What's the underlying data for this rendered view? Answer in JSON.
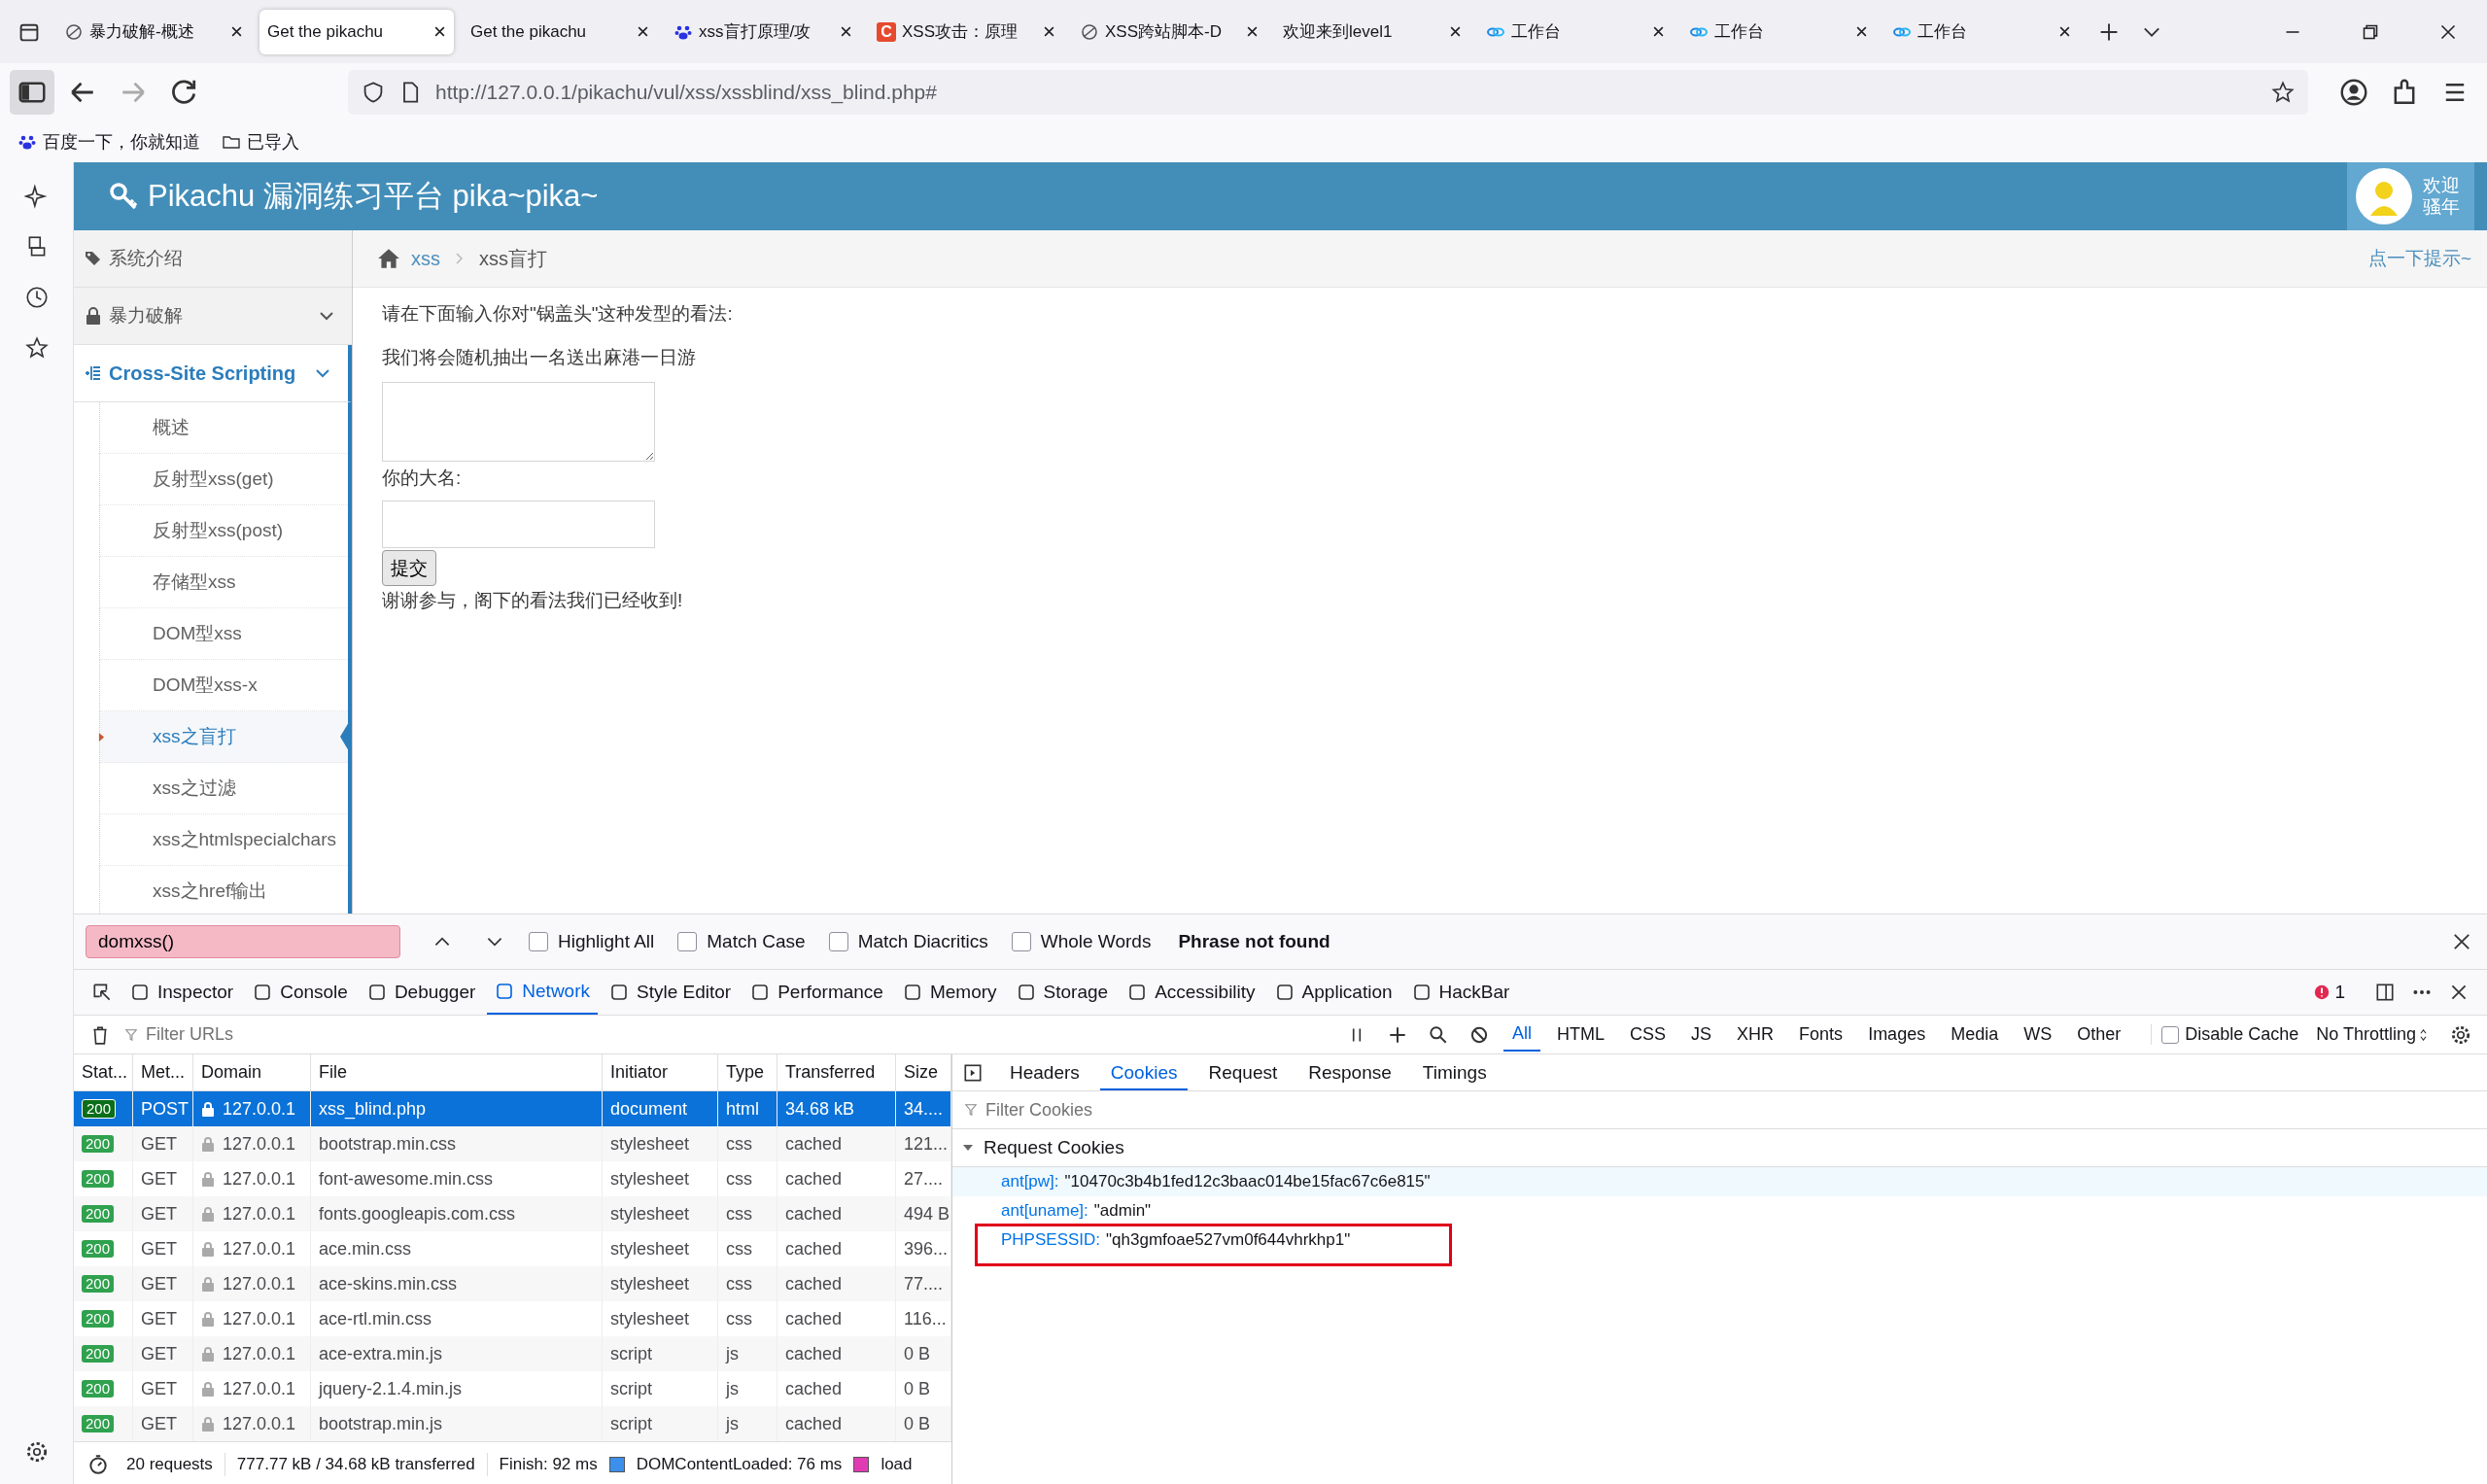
{
  "browser": {
    "tabs": [
      {
        "label": "暴力破解-概述",
        "selected": false
      },
      {
        "label": "Get the pikachu",
        "selected": true
      },
      {
        "label": "Get the pikachu",
        "selected": false
      },
      {
        "label": "xss盲打原理/攻",
        "selected": false
      },
      {
        "label": "XSS攻击：原理",
        "selected": false,
        "icon_text": "C"
      },
      {
        "label": "XSS跨站脚本-D",
        "selected": false
      },
      {
        "label": "欢迎来到level1",
        "selected": false
      },
      {
        "label": "工作台",
        "selected": false
      },
      {
        "label": "工作台",
        "selected": false
      },
      {
        "label": "工作台",
        "selected": false
      }
    ],
    "url_host": "http://127.0.0.1",
    "url_path": "/pikachu/vul/xss/xssblind/xss_blind.php#",
    "bookmarks": [
      {
        "label": "百度一下，你就知道"
      },
      {
        "label": "已导入"
      }
    ]
  },
  "page": {
    "title": "Pikachu 漏洞练习平台 pika~pika~",
    "welcome": [
      "欢迎",
      "骚年"
    ],
    "sidebar": [
      {
        "label": "系统介绍"
      },
      {
        "label": "暴力破解",
        "expanded": false
      },
      {
        "label": "Cross-Site Scripting",
        "expanded": true,
        "children": [
          {
            "label": "概述",
            "selected": false
          },
          {
            "label": "反射型xss(get)",
            "selected": false
          },
          {
            "label": "反射型xss(post)",
            "selected": false
          },
          {
            "label": "存储型xss",
            "selected": false
          },
          {
            "label": "DOM型xss",
            "selected": false
          },
          {
            "label": "DOM型xss-x",
            "selected": false
          },
          {
            "label": "xss之盲打",
            "selected": true
          },
          {
            "label": "xss之过滤",
            "selected": false
          },
          {
            "label": "xss之htmlspecialchars",
            "selected": false
          },
          {
            "label": "xss之href输出",
            "selected": false
          }
        ]
      }
    ],
    "breadcrumb": [
      "xss",
      "xss盲打"
    ],
    "hint_link": "点一下提示~",
    "prompt": "请在下面输入你对\"锅盖头\"这种发型的看法:",
    "prompt_2": "我们将会随机抽出一名送出麻港一日游",
    "name_label": "你的大名:",
    "submit": "提交",
    "thanks": "谢谢参与，阁下的看法我们已经收到!"
  },
  "find_bar": {
    "value": "domxss()",
    "options": [
      {
        "label": "Highlight All",
        "checked": false
      },
      {
        "label": "Match Case",
        "checked": false
      },
      {
        "label": "Match Diacritics",
        "checked": false
      },
      {
        "label": "Whole Words",
        "checked": false
      }
    ],
    "status": "Phrase not found"
  },
  "devtools": {
    "tools": [
      {
        "label": "Inspector",
        "selected": false
      },
      {
        "label": "Console",
        "selected": false
      },
      {
        "label": "Debugger",
        "selected": false
      },
      {
        "label": "Network",
        "selected": true
      },
      {
        "label": "Style Editor",
        "selected": false
      },
      {
        "label": "Performance",
        "selected": false
      },
      {
        "label": "Memory",
        "selected": false
      },
      {
        "label": "Storage",
        "selected": false
      },
      {
        "label": "Accessibility",
        "selected": false
      },
      {
        "label": "Application",
        "selected": false
      },
      {
        "label": "HackBar",
        "selected": false
      }
    ],
    "error_count": "1",
    "filter_placeholder": "Filter URLs",
    "type_filters": [
      {
        "label": "All",
        "selected": true
      },
      {
        "label": "HTML",
        "selected": false
      },
      {
        "label": "CSS",
        "selected": false
      },
      {
        "label": "JS",
        "selected": false
      },
      {
        "label": "XHR",
        "selected": false
      },
      {
        "label": "Fonts",
        "selected": false
      },
      {
        "label": "Images",
        "selected": false
      },
      {
        "label": "Media",
        "selected": false
      },
      {
        "label": "WS",
        "selected": false
      },
      {
        "label": "Other",
        "selected": false
      }
    ],
    "disable_cache": {
      "label": "Disable Cache",
      "checked": false
    },
    "throttling": "No Throttling",
    "columns": [
      "Stat...",
      "Met...",
      "Domain",
      "File",
      "Initiator",
      "Type",
      "Transferred",
      "Size"
    ],
    "rows": [
      {
        "status": "200",
        "method": "POST",
        "domain": "127.0.0.1",
        "file": "xss_blind.php",
        "initiator": "document",
        "type": "html",
        "transferred": "34.68 kB",
        "size": "34....",
        "selected": true
      },
      {
        "status": "200",
        "method": "GET",
        "domain": "127.0.0.1",
        "file": "bootstrap.min.css",
        "initiator": "stylesheet",
        "type": "css",
        "transferred": "cached",
        "size": "121...",
        "selected": false
      },
      {
        "status": "200",
        "method": "GET",
        "domain": "127.0.0.1",
        "file": "font-awesome.min.css",
        "initiator": "stylesheet",
        "type": "css",
        "transferred": "cached",
        "size": "27....",
        "selected": false
      },
      {
        "status": "200",
        "method": "GET",
        "domain": "127.0.0.1",
        "file": "fonts.googleapis.com.css",
        "initiator": "stylesheet",
        "type": "css",
        "transferred": "cached",
        "size": "494 B",
        "selected": false
      },
      {
        "status": "200",
        "method": "GET",
        "domain": "127.0.0.1",
        "file": "ace.min.css",
        "initiator": "stylesheet",
        "type": "css",
        "transferred": "cached",
        "size": "396...",
        "selected": false
      },
      {
        "status": "200",
        "method": "GET",
        "domain": "127.0.0.1",
        "file": "ace-skins.min.css",
        "initiator": "stylesheet",
        "type": "css",
        "transferred": "cached",
        "size": "77....",
        "selected": false
      },
      {
        "status": "200",
        "method": "GET",
        "domain": "127.0.0.1",
        "file": "ace-rtl.min.css",
        "initiator": "stylesheet",
        "type": "css",
        "transferred": "cached",
        "size": "116...",
        "selected": false
      },
      {
        "status": "200",
        "method": "GET",
        "domain": "127.0.0.1",
        "file": "ace-extra.min.js",
        "initiator": "script",
        "type": "js",
        "transferred": "cached",
        "size": "0 B",
        "selected": false
      },
      {
        "status": "200",
        "method": "GET",
        "domain": "127.0.0.1",
        "file": "jquery-2.1.4.min.js",
        "initiator": "script",
        "type": "js",
        "transferred": "cached",
        "size": "0 B",
        "selected": false
      },
      {
        "status": "200",
        "method": "GET",
        "domain": "127.0.0.1",
        "file": "bootstrap.min.js",
        "initiator": "script",
        "type": "js",
        "transferred": "cached",
        "size": "0 B",
        "selected": false
      }
    ],
    "summary": {
      "requests": "20 requests",
      "transferred": "777.77 kB / 34.68 kB transferred",
      "finish": "Finish: 92 ms",
      "dom_loaded": "DOMContentLoaded: 76 ms",
      "load": "load"
    },
    "detail_tabs": [
      {
        "label": "Headers",
        "selected": false
      },
      {
        "label": "Cookies",
        "selected": true
      },
      {
        "label": "Request",
        "selected": false
      },
      {
        "label": "Response",
        "selected": false
      },
      {
        "label": "Timings",
        "selected": false
      }
    ],
    "filter_cookies_placeholder": "Filter Cookies",
    "section": "Request Cookies",
    "cookies": [
      {
        "name": "ant[pw]:",
        "value": "\"10470c3b4b1fed12c3baac014be15fac67c6e815\"",
        "selected": true,
        "highlighted": false
      },
      {
        "name": "ant[uname]:",
        "value": "\"admin\"",
        "selected": false,
        "highlighted": false
      },
      {
        "name": "PHPSESSID:",
        "value": "\"qh3gmfoae527vm0f644vhrkhp1\"",
        "selected": false,
        "highlighted": true
      }
    ]
  }
}
